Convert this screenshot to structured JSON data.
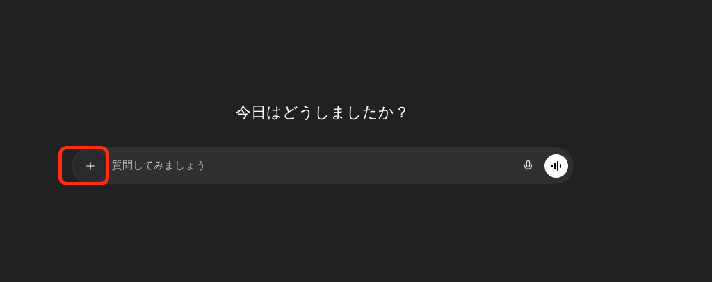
{
  "heading": "今日はどうしましたか？",
  "composer": {
    "placeholder": "質問してみましょう",
    "add_button": {
      "highlighted": true
    }
  }
}
